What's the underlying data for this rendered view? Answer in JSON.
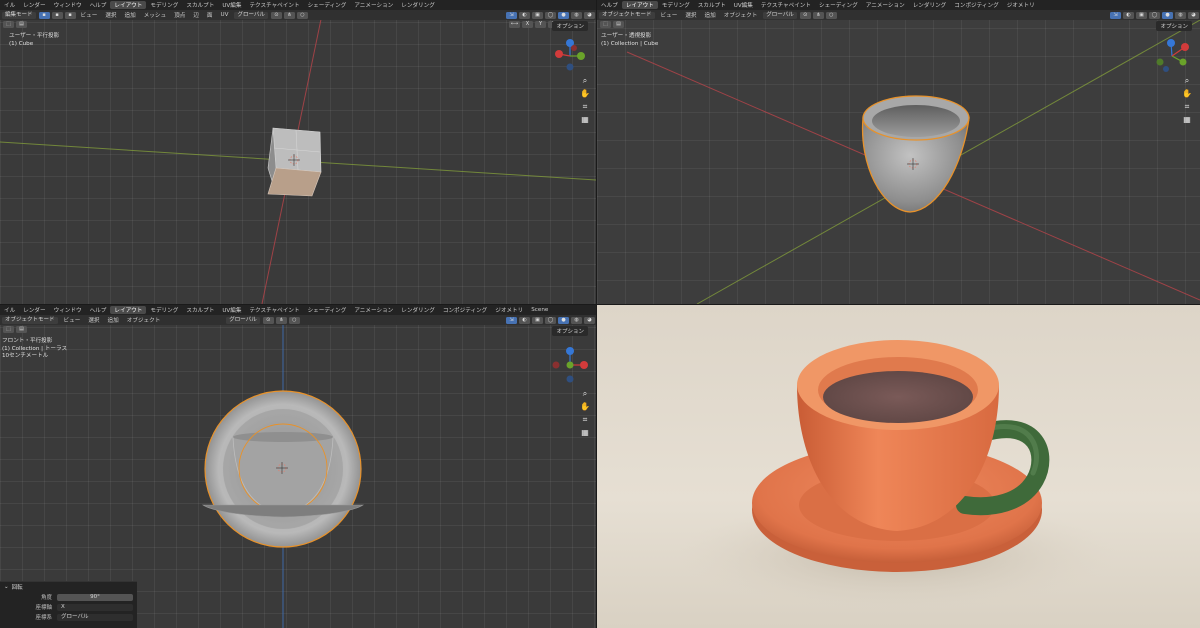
{
  "menu": {
    "items": [
      "イル",
      "レンダー",
      "ウィンドウ",
      "ヘルプ",
      "レイアウト",
      "モデリング",
      "スカルプト",
      "UV編集",
      "テクスチャペイント",
      "シェーディング",
      "アニメーション",
      "レンダリング",
      "コンポジティング",
      "ジオメトリ"
    ],
    "active": "レイアウト",
    "scene": "Scene"
  },
  "viewports": {
    "top_left": {
      "mode": "編集モード",
      "header_items": [
        "ビュー",
        "選択",
        "追加",
        "メッシュ",
        "頂点",
        "辺",
        "面",
        "UV"
      ],
      "transform": "グローバル",
      "options": "オプション",
      "view_name": "ユーザー・平行投影",
      "object": "(1) Cube"
    },
    "top_right": {
      "mode": "オブジェクトモード",
      "header_items": [
        "ビュー",
        "選択",
        "追加",
        "オブジェクト"
      ],
      "transform": "グローバル",
      "options": "オプション",
      "view_name": "ユーザー・透視投影",
      "object": "(1) Collection | Cube",
      "menu_items": [
        "ヘルプ",
        "レイアウト",
        "モデリング",
        "スカルプト",
        "UV編集",
        "テクスチャペイント",
        "シェーディング",
        "アニメーション",
        "レンダリング",
        "コンポジティング",
        "ジオメトリ"
      ]
    },
    "bottom_left": {
      "mode": "オブジェクトモード",
      "header_items": [
        "ビュー",
        "選択",
        "追加",
        "オブジェクト"
      ],
      "transform": "グローバル",
      "options": "オプション",
      "view_name": "フロント・平行投影",
      "object": "(1) Collection | トーラス",
      "scale": "10センチメートル"
    }
  },
  "redo_panel": {
    "title": "回転",
    "angle_label": "角度",
    "angle_value": "90°",
    "axis_label": "座標軸",
    "axis_value": "X",
    "orient_label": "座標系",
    "orient_value": "グローバル"
  },
  "gizmo_axes": {
    "x": "X",
    "y": "Y",
    "z": "Z"
  },
  "colors": {
    "cup": "#e07448",
    "handle": "#3f6a3a",
    "selection": "#e8922a",
    "x_axis": "#d23b3b",
    "y_axis": "#6aa32a",
    "z_axis": "#3577d6"
  }
}
